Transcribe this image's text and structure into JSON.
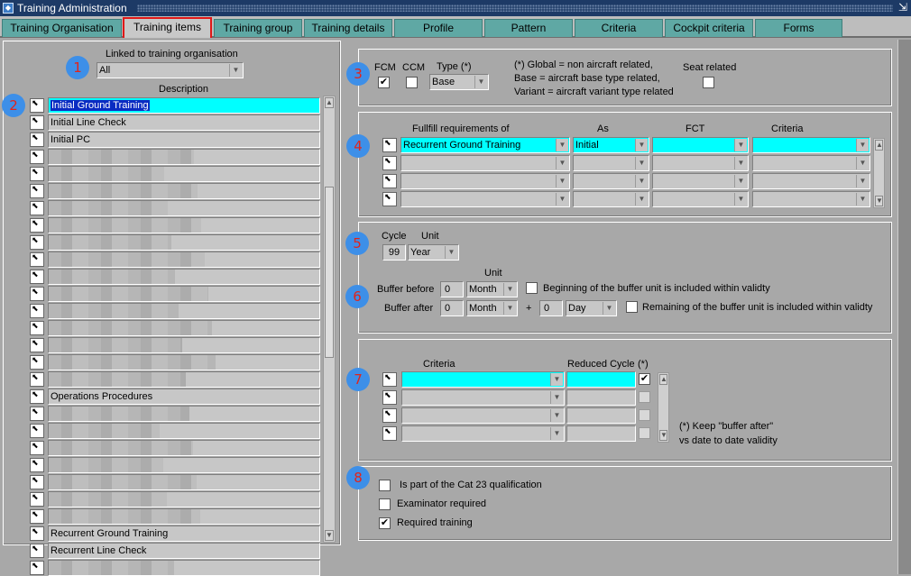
{
  "window": {
    "title": "Training Administration"
  },
  "tabs": [
    {
      "label": "Training Organisation"
    },
    {
      "label": "Training items"
    },
    {
      "label": "Training group"
    },
    {
      "label": "Training details"
    },
    {
      "label": "Profile"
    },
    {
      "label": "Pattern"
    },
    {
      "label": "Criteria"
    },
    {
      "label": "Cockpit criteria"
    },
    {
      "label": "Forms"
    }
  ],
  "badges": [
    "1",
    "2",
    "3",
    "4",
    "5",
    "6",
    "7",
    "8"
  ],
  "left": {
    "linked_label": "Linked to training organisation",
    "linked_value": "All",
    "description_header": "Description",
    "items": [
      "Initial Ground Training",
      "Initial Line Check",
      "Initial PC",
      "",
      "",
      "",
      "",
      "",
      "",
      "",
      "",
      "",
      "",
      "",
      "",
      "",
      "",
      "Operations Procedures",
      "",
      "",
      "",
      "",
      "",
      "",
      "",
      "Recurrent Ground Training",
      "Recurrent Line Check",
      ""
    ]
  },
  "section3": {
    "fcm_label": "FCM",
    "ccm_label": "CCM",
    "type_label": "Type (*)",
    "type_value": "Base",
    "note_line1": "(*) Global = non aircraft related,",
    "note_line2": "Base = aircraft base type related,",
    "note_line3": "Variant = aircraft variant type related",
    "seat_label": "Seat related",
    "fcm_checked": "✔",
    "ccm_checked": "",
    "seat_checked": ""
  },
  "section4": {
    "col_requirements": "Fullfill requirements of",
    "col_as": "As",
    "col_fct": "FCT",
    "col_criteria": "Criteria",
    "row1_requirement": "Recurrent Ground Training",
    "row1_as": "Initial"
  },
  "section5": {
    "cycle_label": "Cycle",
    "unit_label": "Unit",
    "cycle_value": "99",
    "unit_value": "Year"
  },
  "section6": {
    "unit_label": "Unit",
    "buffer_before_label": "Buffer before",
    "buffer_before_value": "0",
    "buffer_before_unit": "Month",
    "beginning_label": "Beginning of the buffer unit is included within validty",
    "buffer_after_label": "Buffer after",
    "buffer_after_value": "0",
    "buffer_after_unit": "Month",
    "plus": "+",
    "buffer_after_extra_value": "0",
    "buffer_after_extra_unit": "Day",
    "remaining_label": "Remaining of the buffer unit is included within validty"
  },
  "section7": {
    "criteria_label": "Criteria",
    "reduced_label": "Reduced Cycle",
    "star_label": "(*)",
    "note_line1": "(*) Keep \"buffer after\"",
    "note_line2": "vs date to date validity",
    "row1_checked": "✔"
  },
  "section8": {
    "cat23_label": "Is part of the Cat 23 qualification",
    "examiner_label": "Examinator required",
    "required_label": "Required training",
    "cat23_checked": "",
    "examiner_checked": "",
    "required_checked": "✔"
  }
}
